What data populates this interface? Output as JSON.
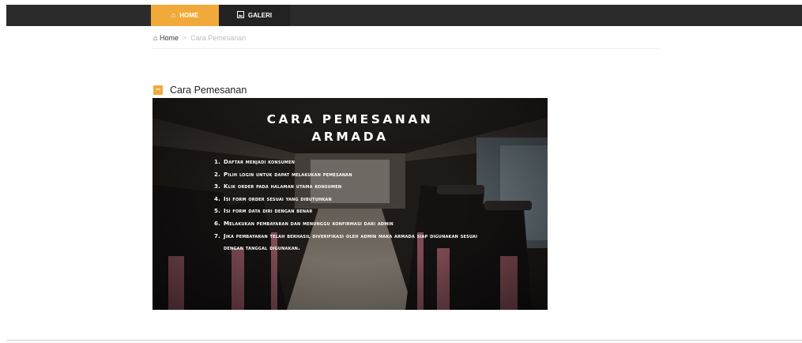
{
  "nav": {
    "home_icon": "home-icon",
    "home_label": "HOME",
    "galeri_icon": "image-icon",
    "galeri_label": "GALERI",
    "accent_color": "#f1aa3a",
    "bar_color": "#2b2b2b"
  },
  "breadcrumb": {
    "home_label": "Home",
    "separator": ">",
    "current": "Cara Pemesanan"
  },
  "section": {
    "title": "Cara Pemesanan"
  },
  "banner": {
    "title_line1": "CARA PEMESANAN",
    "title_line2": "ARMADA",
    "steps": [
      {
        "num": "1.",
        "text": "Daftar menjadi konsumen"
      },
      {
        "num": "2.",
        "text": "Pilih login untuk dapat melakukan pemesanan"
      },
      {
        "num": "3.",
        "text": "Klik order pada halaman utama konsumen"
      },
      {
        "num": "4.",
        "text": "Isi form order sesuai yang dibutuhkan"
      },
      {
        "num": "5.",
        "text": "Isi form data diri dengan benar"
      },
      {
        "num": "6.",
        "text": "Melakukan pembayaran dan menunggu konfirmasi dari admin"
      },
      {
        "num": "7.",
        "text": "Jika pembayaran telah berhasil diverifikasi oleh admin maka armada siap digunakan sesuai dengan tanggal digunakan."
      }
    ]
  }
}
